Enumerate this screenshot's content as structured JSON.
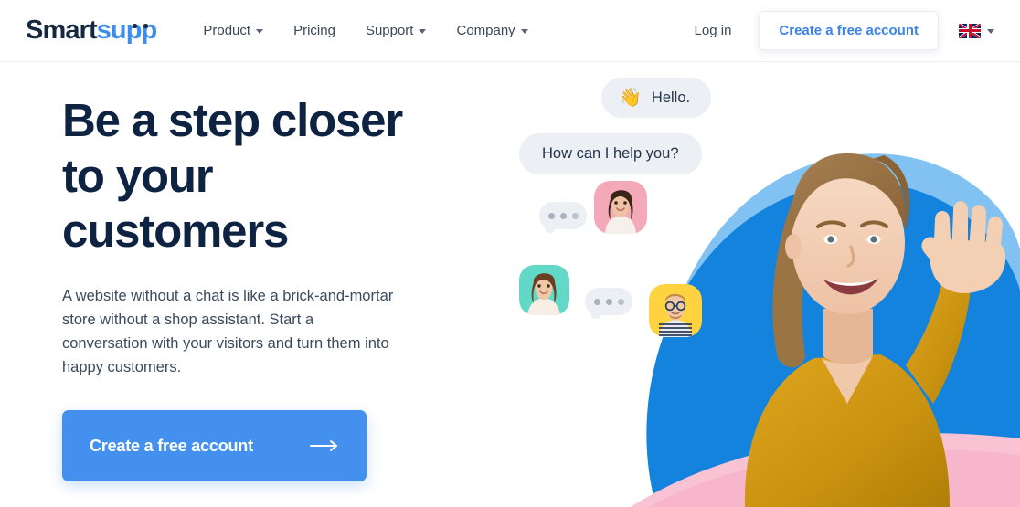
{
  "brand": {
    "logo_smart": "Smart",
    "logo_supp": "supp",
    "accent_blue": "#3b8df0",
    "navy": "#0e2341",
    "cta_blue": "#4390ee",
    "pink": "#f7b6cc",
    "yellow": "#d4a017"
  },
  "header": {
    "nav": [
      {
        "label": "Product",
        "has_dropdown": true
      },
      {
        "label": "Pricing",
        "has_dropdown": false
      },
      {
        "label": "Support",
        "has_dropdown": true
      },
      {
        "label": "Company",
        "has_dropdown": true
      }
    ],
    "login_label": "Log in",
    "cta_label": "Create a free account",
    "language": {
      "flag": "uk-flag-icon",
      "code": "EN"
    }
  },
  "hero": {
    "title_lines": [
      "Be a step closer",
      "to your",
      "customers"
    ],
    "subtitle": "A website without a chat is like a brick-and-mortar store without a shop assistant. Start a conversation with your visitors and turn them into happy customers.",
    "cta_label": "Create a free account",
    "cta_icon": "arrow-right-icon"
  },
  "chat": {
    "messages": [
      {
        "id": "hello",
        "emoji": "👋",
        "text": "Hello."
      },
      {
        "id": "help",
        "emoji": "",
        "text": "How can I help you?"
      }
    ],
    "typing_indicators": 2,
    "avatars": [
      {
        "id": "pink",
        "name": "avatar-woman-pink",
        "bg": "#f4a9b8"
      },
      {
        "id": "teal",
        "name": "avatar-woman-teal",
        "bg": "#62d9c7"
      },
      {
        "id": "yellow",
        "name": "avatar-man-yellow",
        "bg": "#ffd23f"
      }
    ],
    "hero_person": "waving-woman-photo"
  }
}
